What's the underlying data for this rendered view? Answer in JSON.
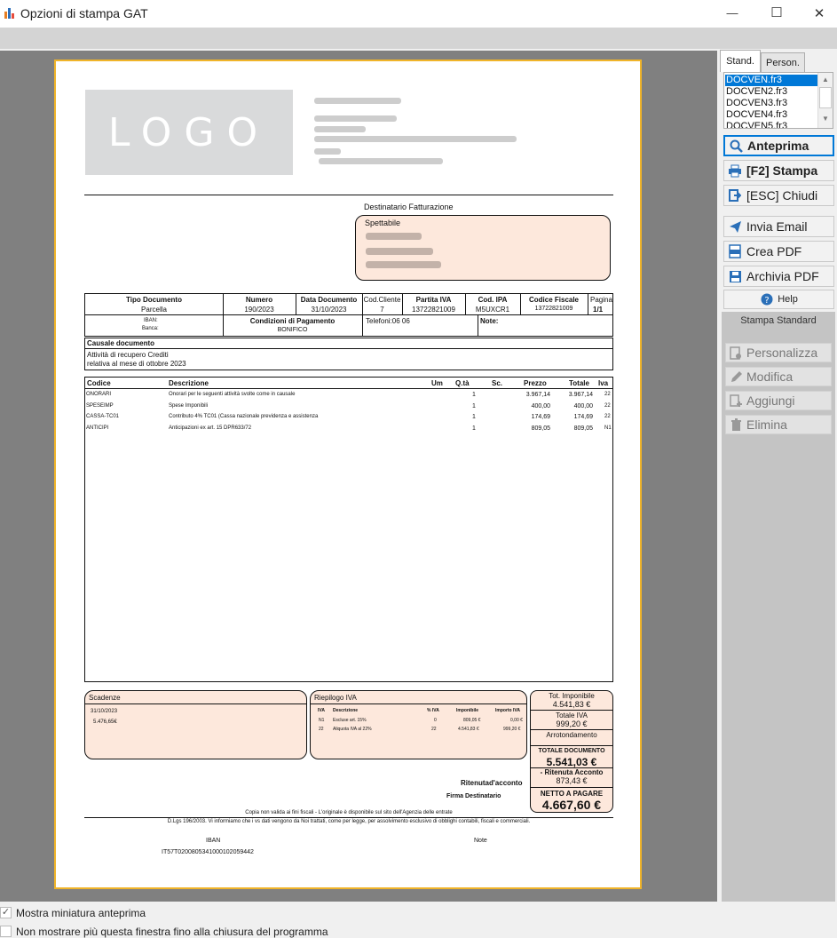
{
  "window": {
    "title": "Opzioni di stampa GAT",
    "minimize_glyph": "—",
    "maximize_glyph": "☐",
    "close_glyph": "✕"
  },
  "tabs": {
    "standard": "Stand.",
    "personal": "Person."
  },
  "templates": [
    "DOCVEN.fr3",
    "DOCVEN2.fr3",
    "DOCVEN3.fr3",
    "DOCVEN4.fr3",
    "DOCVEN5.fr3"
  ],
  "selected_template": "DOCVEN.fr3",
  "actions": {
    "preview": "Anteprima",
    "print": "[F2] Stampa",
    "close": "[ESC] Chiudi",
    "email": "Invia Email",
    "pdf": "Crea PDF",
    "archive_pdf": "Archivia PDF",
    "help": "Help"
  },
  "section_title": "Stampa Standard",
  "edit_actions": {
    "customize": "Personalizza",
    "modify": "Modifica",
    "add": "Aggiungi",
    "delete": "Elimina"
  },
  "options": {
    "show_preview": "Mostra miniatura anteprima",
    "show_preview_checked": true,
    "dont_show": "Non mostrare più questa finestra fino alla chiusura del programma",
    "dont_show_checked": false
  },
  "doc": {
    "logo": "LOGO",
    "recipient_title": "Destinatario Fatturazione",
    "recipient_salutation": "Spettabile",
    "headers": {
      "tipo": "Tipo Documento",
      "numero": "Numero",
      "data": "Data Documento",
      "cod_cliente": "Cod.Cliente",
      "piva": "Partita IVA",
      "ipa": "Cod. IPA",
      "cf": "Codice Fiscale",
      "pagina": "Pagina"
    },
    "values": {
      "tipo": "Parcella",
      "numero": "190/2023",
      "data": "31/10/2023",
      "cod_cliente": "7",
      "piva": "13722821009",
      "ipa": "M5UXCR1",
      "cf": "13722821009",
      "pagina": "1/1"
    },
    "iban_label": "IBAN:",
    "banca_label": "Banca:",
    "pagamento_label": "Condizioni di Pagamento",
    "pagamento_value": "BONIFICO",
    "telefoni": "Telefoni:06 06",
    "note_label": "Note:",
    "causale_label": "Causale documento",
    "causale_line1": "Attività di recupero Crediti",
    "causale_line2": "relativa al mese di ottobre 2023",
    "table_headers": {
      "codice": "Codice",
      "descrizione": "Descrizione",
      "um": "Um",
      "qta": "Q.tà",
      "sc": "Sc.",
      "prezzo": "Prezzo",
      "totale": "Totale",
      "iva": "Iva"
    },
    "rows": [
      {
        "codice": "ONORARI",
        "descrizione": "Onorari per le seguenti attività svolte come in causale",
        "qta": "1",
        "prezzo": "3.967,14",
        "totale": "3.967,14",
        "iva": "22"
      },
      {
        "codice": "SPESEIMP",
        "descrizione": "Spese Imponibili",
        "qta": "1",
        "prezzo": "400,00",
        "totale": "400,00",
        "iva": "22"
      },
      {
        "codice": "CASSA-TC01",
        "descrizione": "Contributo 4% TC01 (Cassa nazionale previdenza e assistenza",
        "qta": "1",
        "prezzo": "174,69",
        "totale": "174,69",
        "iva": "22"
      },
      {
        "codice": "ANTICIPI",
        "descrizione": "Anticipazioni ex art. 15 DPR633/72",
        "qta": "1",
        "prezzo": "809,05",
        "totale": "809,05",
        "iva": "N1"
      }
    ],
    "scadenze_title": "Scadenze",
    "scadenza_date": "31/10/2023",
    "scadenza_amount": "5.476,65€",
    "riepilogo_title": "Riepilogo IVA",
    "riepilogo_headers": {
      "iva": "IVA",
      "descrizione": "Descrizione",
      "perc": "% IVA",
      "imponibile": "Imponibile",
      "importo": "Importo IVA"
    },
    "riepilogo_rows": [
      {
        "iva": "N1",
        "descrizione": "Escluse art. 15%",
        "perc": "0",
        "imponibile": "809,05 €",
        "importo": "0,00 €"
      },
      {
        "iva": "22",
        "descrizione": "Aliquota IVA al 22%",
        "perc": "22",
        "imponibile": "4.541,83 €",
        "importo": "999,20 €"
      }
    ],
    "tot_imponibile_label": "Tot. Imponibile",
    "tot_imponibile": "4.541,83 €",
    "totale_iva_label": "Totale IVA",
    "totale_iva": "999,20 €",
    "arrotondamento_label": "Arrotondamento",
    "totale_documento_label": "TOTALE DOCUMENTO",
    "totale_documento": "5.541,03 €",
    "ritenuta_acconto_label": "- Ritenuta Acconto",
    "ritenuta_acconto": "873,43 €",
    "netto_label": "NETTO A PAGARE",
    "netto": "4.667,60 €",
    "ritenuta_label": "Ritenutad'acconto",
    "firma_label": "Firma Destinatario",
    "footer1": "Copia non valida ai fini fiscali - L'originale è disponibile sul sito dell'Agenzia delle entrate",
    "footer2": "D.Lgs 196/2003. Vi informiamo che i vs dati vengono da Noi trattati, come per legge, per assolvimento esclusivo di obblighi contabili, fiscali e commerciali.",
    "iban_footer_label": "IBAN",
    "iban_footer_value": "IT57T0200805341000102059442",
    "note_footer_label": "Note"
  },
  "colors": {
    "accent": "#0078d7",
    "paper_border": "#f0b429",
    "pink": "#fde8dc",
    "preview_bg": "#808080"
  }
}
